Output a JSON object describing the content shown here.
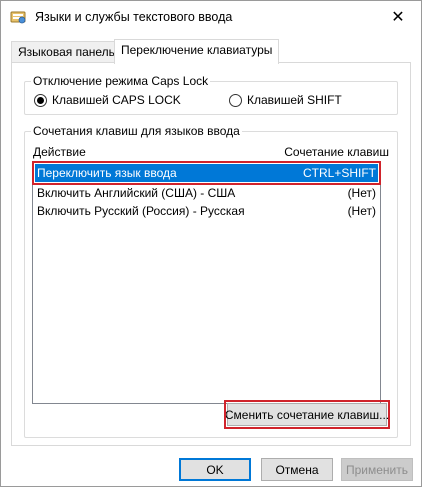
{
  "window": {
    "title": "Языки и службы текстового ввода",
    "close_glyph": "✕"
  },
  "tabs": [
    {
      "label": "Языковая панель",
      "active": false
    },
    {
      "label": "Переключение клавиатуры",
      "active": true
    }
  ],
  "capslock_group": {
    "legend": "Отключение режима Caps Lock",
    "options": [
      {
        "label": "Клавишей CAPS LOCK",
        "checked": true
      },
      {
        "label": "Клавишей SHIFT",
        "checked": false
      }
    ]
  },
  "hotkeys_group": {
    "legend": "Сочетания клавиш для языков ввода",
    "col_action": "Действие",
    "col_hotkey": "Сочетание клавиш",
    "rows": [
      {
        "action": "Переключить язык ввода",
        "hotkey": "CTRL+SHIFT",
        "selected": true
      },
      {
        "action": "Включить Английский (США) - США",
        "hotkey": "(Нет)",
        "selected": false
      },
      {
        "action": "Включить Русский (Россия) - Русская",
        "hotkey": "(Нет)",
        "selected": false
      }
    ],
    "change_button": "Сменить сочетание клавиш..."
  },
  "buttons": {
    "ok": "OK",
    "cancel": "Отмена",
    "apply": "Применить"
  },
  "colors": {
    "selection": "#0078d7",
    "highlight_outline": "#d0232b"
  }
}
